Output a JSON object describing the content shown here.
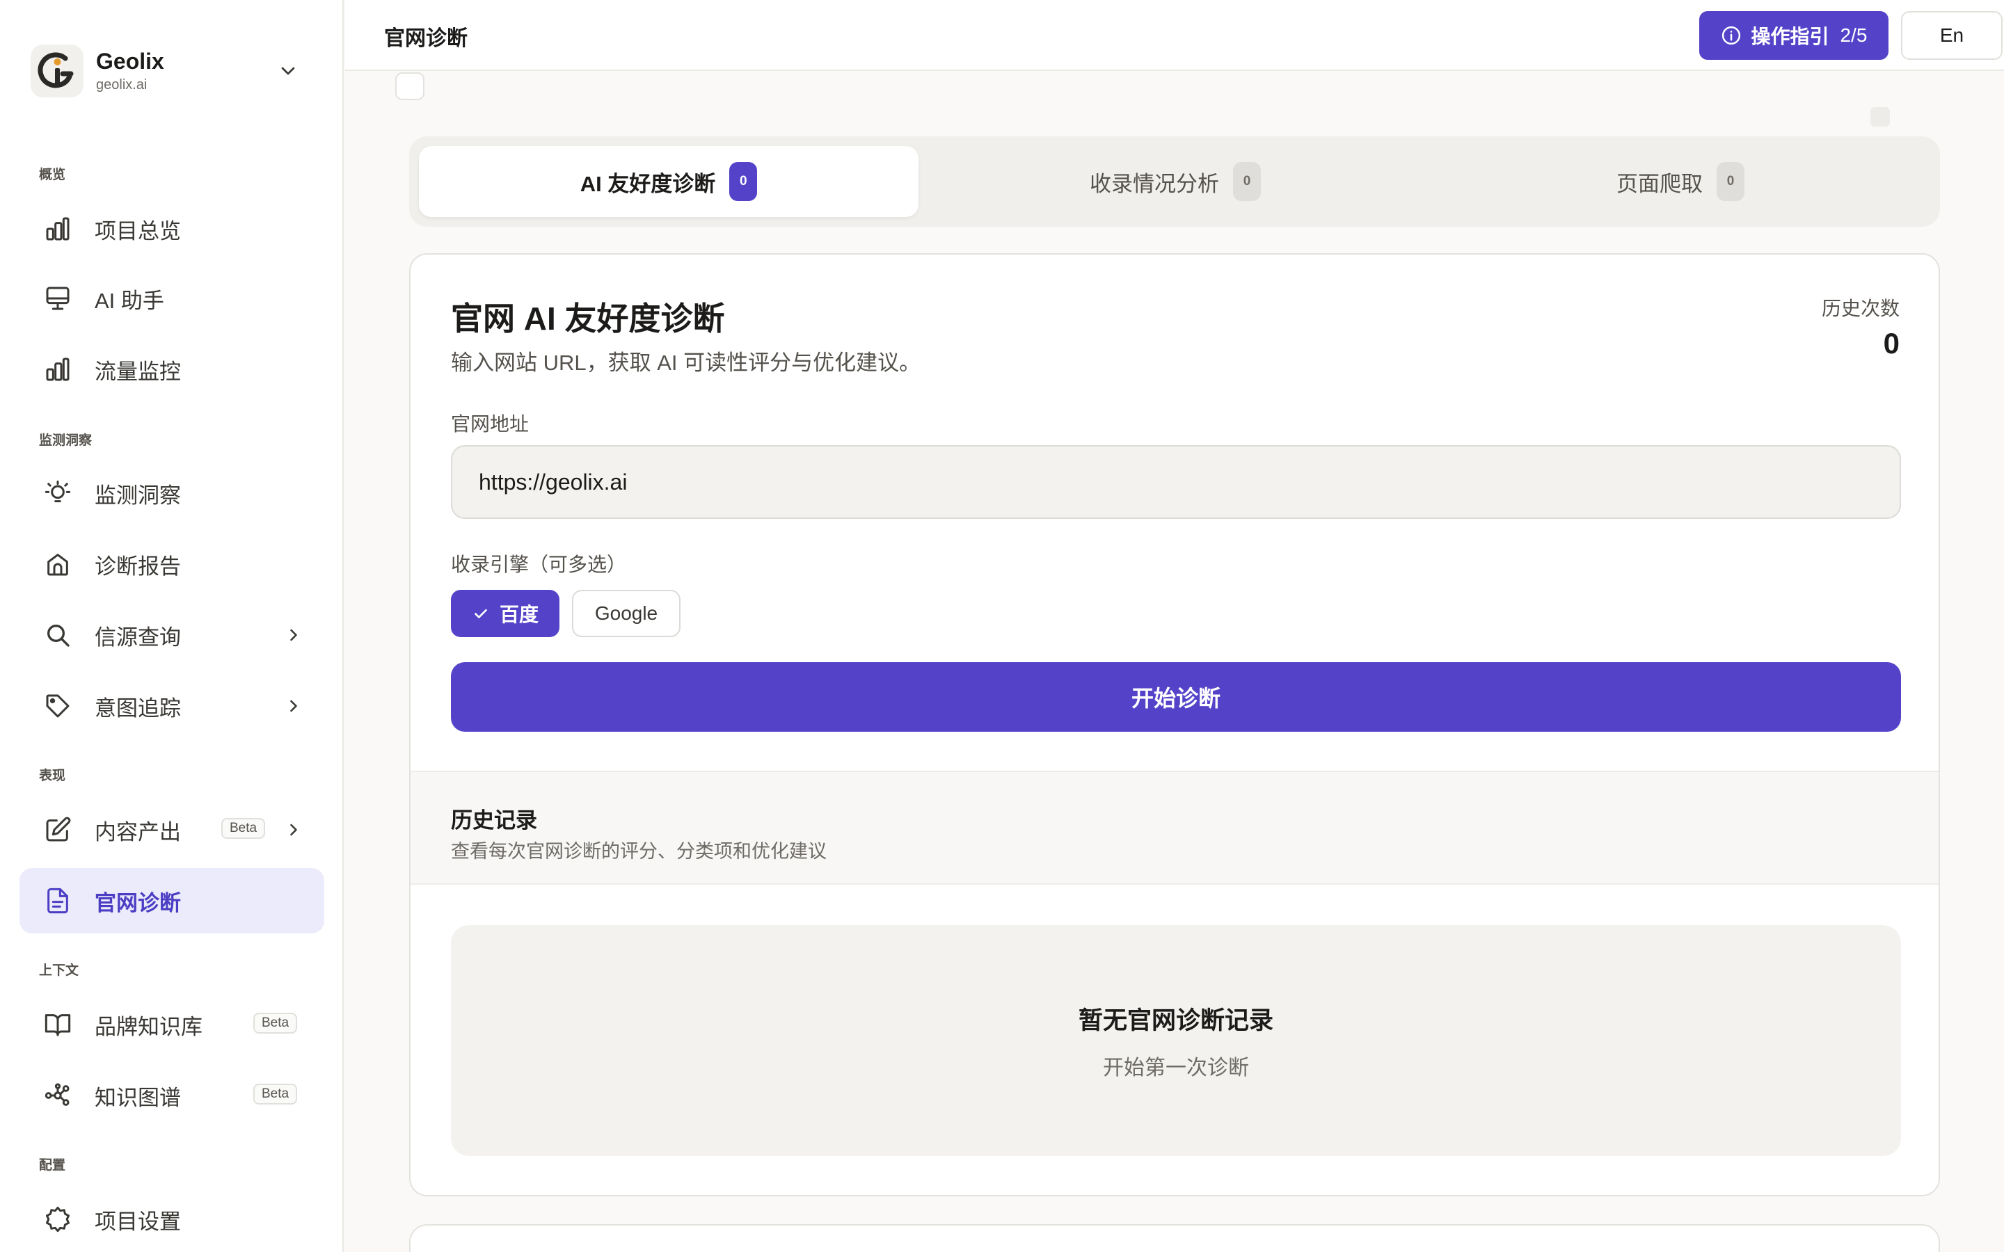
{
  "brand": {
    "name": "Geolix",
    "domain": "geolix.ai"
  },
  "colors": {
    "accent": "#5443c9",
    "active_bg": "#ecebfb",
    "surface": "#faf9f7"
  },
  "sidebar": {
    "sections": [
      {
        "label": "概览"
      },
      {
        "label": "监测洞察"
      },
      {
        "label": "表现"
      },
      {
        "label": "上下文"
      },
      {
        "label": "配置"
      }
    ],
    "items": [
      {
        "label": "项目总览",
        "icon": "bar-chart-icon"
      },
      {
        "label": "AI 助手",
        "icon": "monitor-icon"
      },
      {
        "label": "流量监控",
        "icon": "bar-chart-icon"
      },
      {
        "label": "监测洞察",
        "icon": "lightbulb-icon"
      },
      {
        "label": "诊断报告",
        "icon": "report-icon"
      },
      {
        "label": "信源查询",
        "icon": "search-icon"
      },
      {
        "label": "意图追踪",
        "icon": "tag-icon"
      },
      {
        "label": "内容产出",
        "icon": "edit-icon",
        "badge": "Beta"
      },
      {
        "label": "官网诊断",
        "icon": "document-icon",
        "active": true
      },
      {
        "label": "品牌知识库",
        "icon": "book-icon",
        "badge": "Beta"
      },
      {
        "label": "知识图谱",
        "icon": "graph-icon",
        "badge": "Beta"
      },
      {
        "label": "项目设置",
        "icon": "gear-icon"
      }
    ]
  },
  "header": {
    "title": "官网诊断",
    "guide_label": "操作指引",
    "guide_progress": "2/5",
    "lang_label": "En"
  },
  "tabs": [
    {
      "label": "AI 友好度诊断",
      "count": "0",
      "active": true
    },
    {
      "label": "收录情况分析",
      "count": "0"
    },
    {
      "label": "页面爬取",
      "count": "0"
    }
  ],
  "diagnosis": {
    "title": "官网 AI 友好度诊断",
    "subtitle": "输入网站 URL，获取 AI 可读性评分与优化建议。",
    "history_count_label": "历史次数",
    "history_count": "0",
    "url_label": "官网地址",
    "url_value": "https://geolix.ai",
    "engine_label": "收录引擎（可多选）",
    "engines": [
      {
        "label": "百度",
        "selected": true
      },
      {
        "label": "Google",
        "selected": false
      }
    ],
    "start_label": "开始诊断"
  },
  "history": {
    "title": "历史记录",
    "subtitle": "查看每次官网诊断的评分、分类项和优化建议",
    "empty_title": "暂无官网诊断记录",
    "empty_sub": "开始第一次诊断"
  }
}
